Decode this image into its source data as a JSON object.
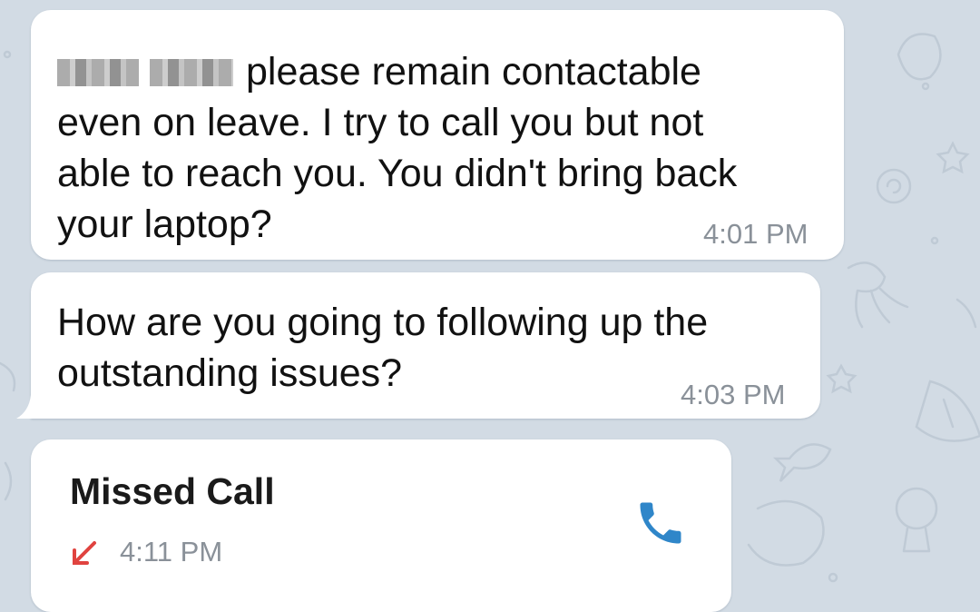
{
  "colors": {
    "background": "#d2dbe4",
    "bubble": "#ffffff",
    "text": "#111111",
    "timestamp": "#8a9199",
    "missed_call_arrow": "#e0433f",
    "call_icon": "#2f86c9"
  },
  "messages": [
    {
      "sender_redacted": true,
      "line1": "please remain contactable",
      "rest": "even on leave. I try to call you but not\nable to reach you. You didn't bring back\nyour laptop?",
      "time": "4:01 PM"
    },
    {
      "text": "How are you going to following up the\noutstanding issues?",
      "time": "4:03 PM"
    }
  ],
  "call": {
    "title": "Missed Call",
    "time": "4:11 PM",
    "direction_icon": "missed-call-arrow-icon",
    "action_icon": "phone-icon"
  }
}
